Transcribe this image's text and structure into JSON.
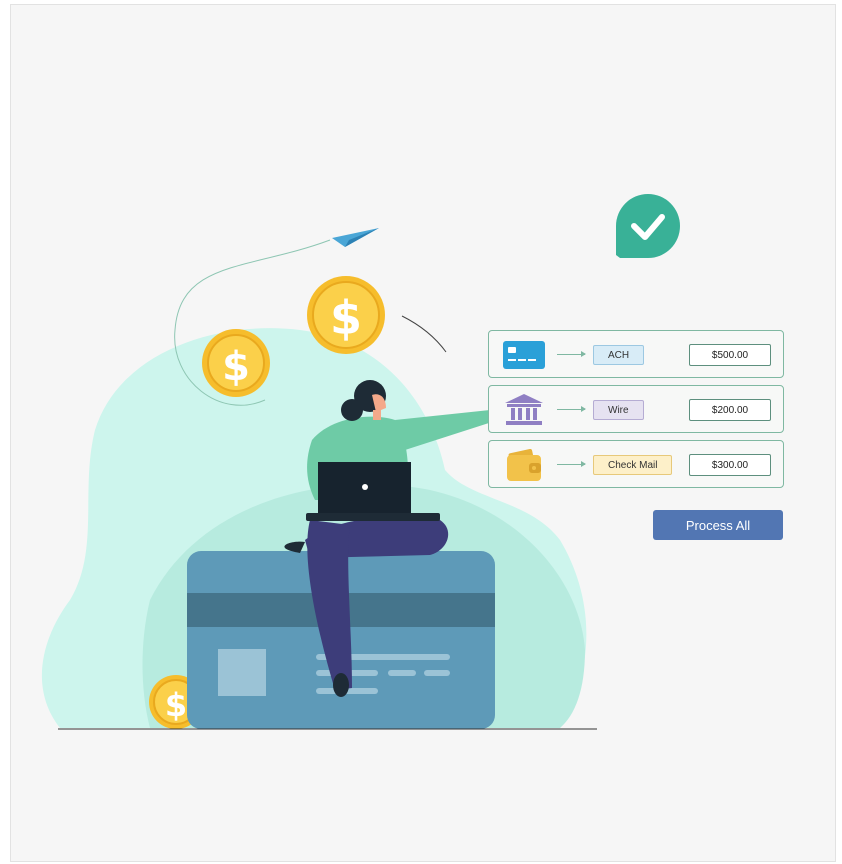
{
  "payments": [
    {
      "icon": "credit-card-icon",
      "method": "ACH",
      "amount": "$500.00"
    },
    {
      "icon": "bank-icon",
      "method": "Wire",
      "amount": "$200.00"
    },
    {
      "icon": "wallet-icon",
      "method": "Check Mail",
      "amount": "$300.00"
    }
  ],
  "actions": {
    "process_all_label": "Process All"
  },
  "colors": {
    "accent_green": "#39b197",
    "button_blue": "#5276b3",
    "coin_gold": "#f6bd2c",
    "card_blue": "#5e9ab8",
    "blob_mint": "#cdf5ed"
  }
}
